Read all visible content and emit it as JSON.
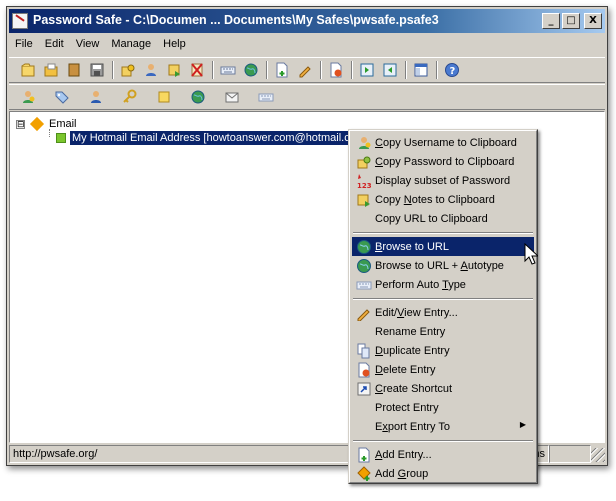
{
  "window": {
    "title": "Password Safe - C:\\Documen ... Documents\\My Safes\\pwsafe.psafe3",
    "min_glyph": "_",
    "max_glyph": "□",
    "close_glyph": "X"
  },
  "menubar": [
    "File",
    "Edit",
    "View",
    "Manage",
    "Help"
  ],
  "toolbar1": [
    "new-database-icon",
    "open-database-icon",
    "close-database-icon",
    "save-icon",
    "copy-password-icon",
    "copy-username-icon",
    "copy-notes-icon",
    "clear-clipboard-icon",
    "autotype-icon",
    "browse-url-icon",
    "add-entry-icon",
    "edit-entry-icon",
    "delete-entry-icon",
    "expand-all-icon",
    "collapse-all-icon",
    "options-icon",
    "help-icon"
  ],
  "toolbar2": [
    "copy-username-icon",
    "tag-icon",
    "user-icon",
    "key-icon",
    "note-icon",
    "globe-icon",
    "email-icon",
    "keyboard-icon"
  ],
  "tree": {
    "group": {
      "expander": "⊟",
      "label": "Email"
    },
    "entry": {
      "label": "My Hotmail Email Address [howtoanswer.com@hotmail.com]",
      "selected": true
    }
  },
  "status": {
    "url": "http://pwsafe.org/",
    "items_suffix": "ems"
  },
  "context_menu": {
    "items": [
      {
        "pre": "",
        "ul": "C",
        "post": "opy Username to Clipboard",
        "icon": "copy-username-icon"
      },
      {
        "pre": "",
        "ul": "C",
        "post": "opy Password to Clipboard",
        "icon": "copy-password-icon"
      },
      {
        "pre": "Display subset of Password",
        "ul": "",
        "post": "",
        "icon": "password-subset-icon"
      },
      {
        "pre": "Copy ",
        "ul": "N",
        "post": "otes to Clipboard",
        "icon": "copy-notes-icon"
      },
      {
        "pre": "Copy URL to Clipboard",
        "ul": "",
        "post": "",
        "icon": ""
      },
      {
        "separator": true
      },
      {
        "pre": "",
        "ul": "B",
        "post": "rowse to URL",
        "icon": "browse-url-icon",
        "highlighted": true
      },
      {
        "pre": "Browse to URL + ",
        "ul": "A",
        "post": "utotype",
        "icon": "browse-autotype-icon"
      },
      {
        "pre": "Perform Auto ",
        "ul": "T",
        "post": "ype",
        "icon": "autotype-icon"
      },
      {
        "separator": true
      },
      {
        "pre": "Edit/",
        "ul": "V",
        "post": "iew Entry...",
        "icon": "edit-entry-icon"
      },
      {
        "pre": "Rename Entry",
        "ul": "",
        "post": "",
        "icon": ""
      },
      {
        "pre": "",
        "ul": "D",
        "post": "uplicate Entry",
        "icon": "duplicate-entry-icon"
      },
      {
        "pre": "",
        "ul": "D",
        "post": "elete Entry",
        "icon": "delete-entry-icon"
      },
      {
        "pre": "",
        "ul": "C",
        "post": "reate Shortcut",
        "icon": "create-shortcut-icon"
      },
      {
        "pre": "Protect Entry",
        "ul": "",
        "post": "",
        "icon": ""
      },
      {
        "pre": "E",
        "ul": "x",
        "post": "port Entry To",
        "icon": "",
        "submenu": true,
        "arrow": "▶"
      },
      {
        "separator": true
      },
      {
        "pre": "",
        "ul": "A",
        "post": "dd Entry...",
        "icon": "add-entry-icon"
      },
      {
        "pre": "Add ",
        "ul": "G",
        "post": "roup",
        "icon": "add-group-icon"
      }
    ]
  }
}
